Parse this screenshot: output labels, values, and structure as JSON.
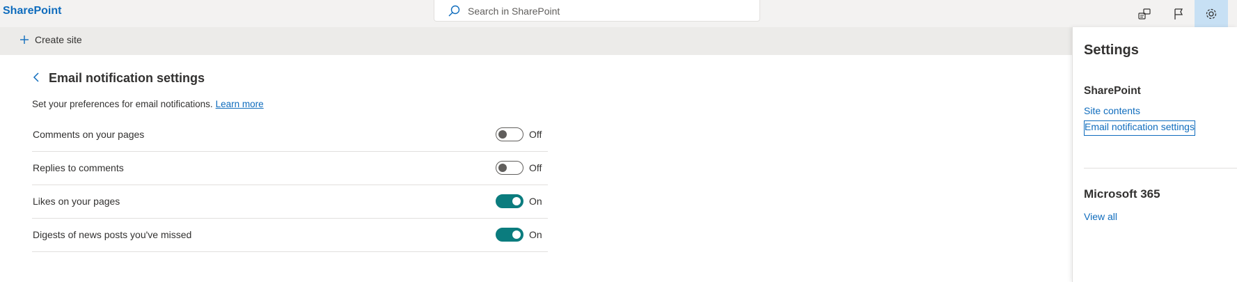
{
  "app": {
    "brand": "SharePoint"
  },
  "search": {
    "placeholder": "Search in SharePoint"
  },
  "header_icons": [
    "feedback-icon",
    "flag-icon",
    "gear-icon"
  ],
  "commandbar": {
    "create_label": "Create site"
  },
  "page": {
    "title": "Email notification settings",
    "description": "Set your preferences for email notifications.",
    "learn_more": "Learn more",
    "settings": [
      {
        "label": "Comments on your pages",
        "state": "Off",
        "on": false
      },
      {
        "label": "Replies to comments",
        "state": "Off",
        "on": false
      },
      {
        "label": "Likes on your pages",
        "state": "On",
        "on": true
      },
      {
        "label": "Digests of news posts you've missed",
        "state": "On",
        "on": true
      }
    ]
  },
  "panel": {
    "title": "Settings",
    "section1": {
      "heading": "SharePoint",
      "links": [
        "Site contents",
        "Email notification settings"
      ]
    },
    "section2": {
      "heading": "Microsoft 365",
      "link": "View all"
    }
  },
  "colors": {
    "brand": "#0f6cbd",
    "toggle_on": "#0b7c7e",
    "active_icon_bg": "#c7e0f4"
  }
}
